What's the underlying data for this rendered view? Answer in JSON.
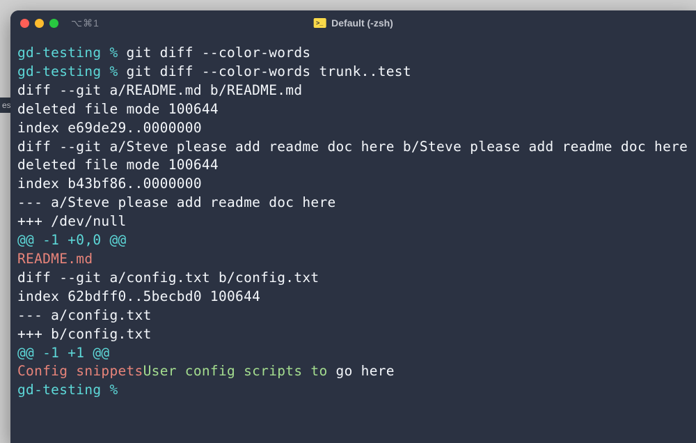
{
  "window": {
    "shortcut": "⌥⌘1",
    "title": "Default (-zsh)"
  },
  "edge_label": "es",
  "prompt": "gd-testing %",
  "lines": {
    "l1_cmd": " git diff --color-words",
    "l2_cmd": " git diff --color-words trunk..test",
    "l3": "diff --git a/README.md b/README.md",
    "l4": "deleted file mode 100644",
    "l5": "index e69de29..0000000",
    "l6": "diff --git a/Steve please add readme doc here b/Steve please add readme doc here",
    "l7": "deleted file mode 100644",
    "l8": "index b43bf86..0000000",
    "l9": "--- a/Steve please add readme doc here",
    "l10": "+++ /dev/null",
    "l11": "@@ -1 +0,0 @@",
    "l12": "README.md",
    "l13": "diff --git a/config.txt b/config.txt",
    "l14": "index 62bdff0..5becbd0 100644",
    "l15": "--- a/config.txt",
    "l16": "+++ b/config.txt",
    "l17": "@@ -1 +1 @@",
    "l18_red": "Config snippets",
    "l18_green": "User config scripts to",
    "l18_white": " go here"
  }
}
